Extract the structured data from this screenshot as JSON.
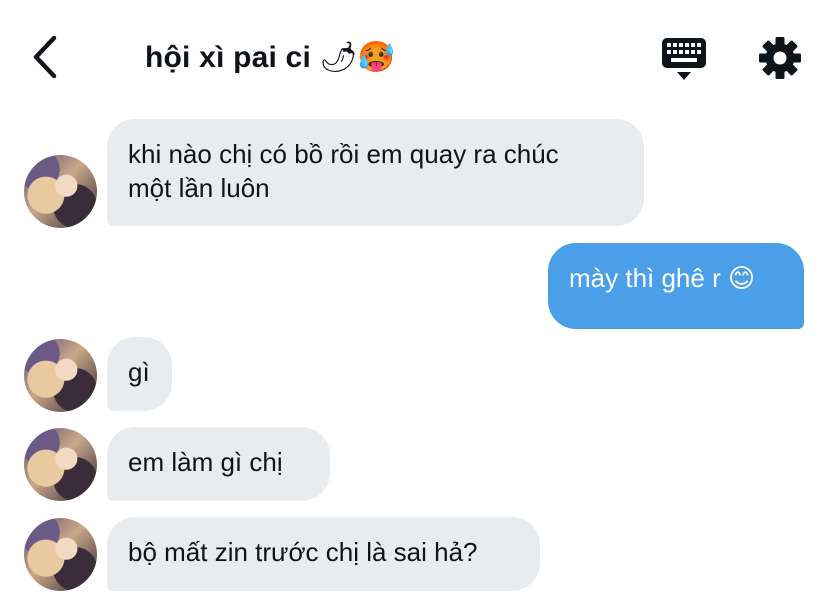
{
  "header": {
    "back_icon": "chevron-left-icon",
    "title": "hội xì pai ci",
    "title_emojis": "🌶🥵",
    "keyboard_icon": "keyboard-icon",
    "settings_icon": "gear-icon"
  },
  "colors": {
    "incoming_bubble": "#e9ecef",
    "outgoing_bubble": "#4b9fe8",
    "text": "#0f1419"
  },
  "messages": [
    {
      "direction": "in",
      "lines": [
        "khi nào chị có bồ rồi em quay ra chúc",
        "một lần luôn"
      ]
    },
    {
      "direction": "out",
      "text": "mày thì ghê r 😊"
    },
    {
      "direction": "in",
      "text": "gì"
    },
    {
      "direction": "in",
      "text": "em làm gì chị"
    },
    {
      "direction": "in",
      "text": "bộ mất zin trước chị là sai hả?"
    }
  ]
}
